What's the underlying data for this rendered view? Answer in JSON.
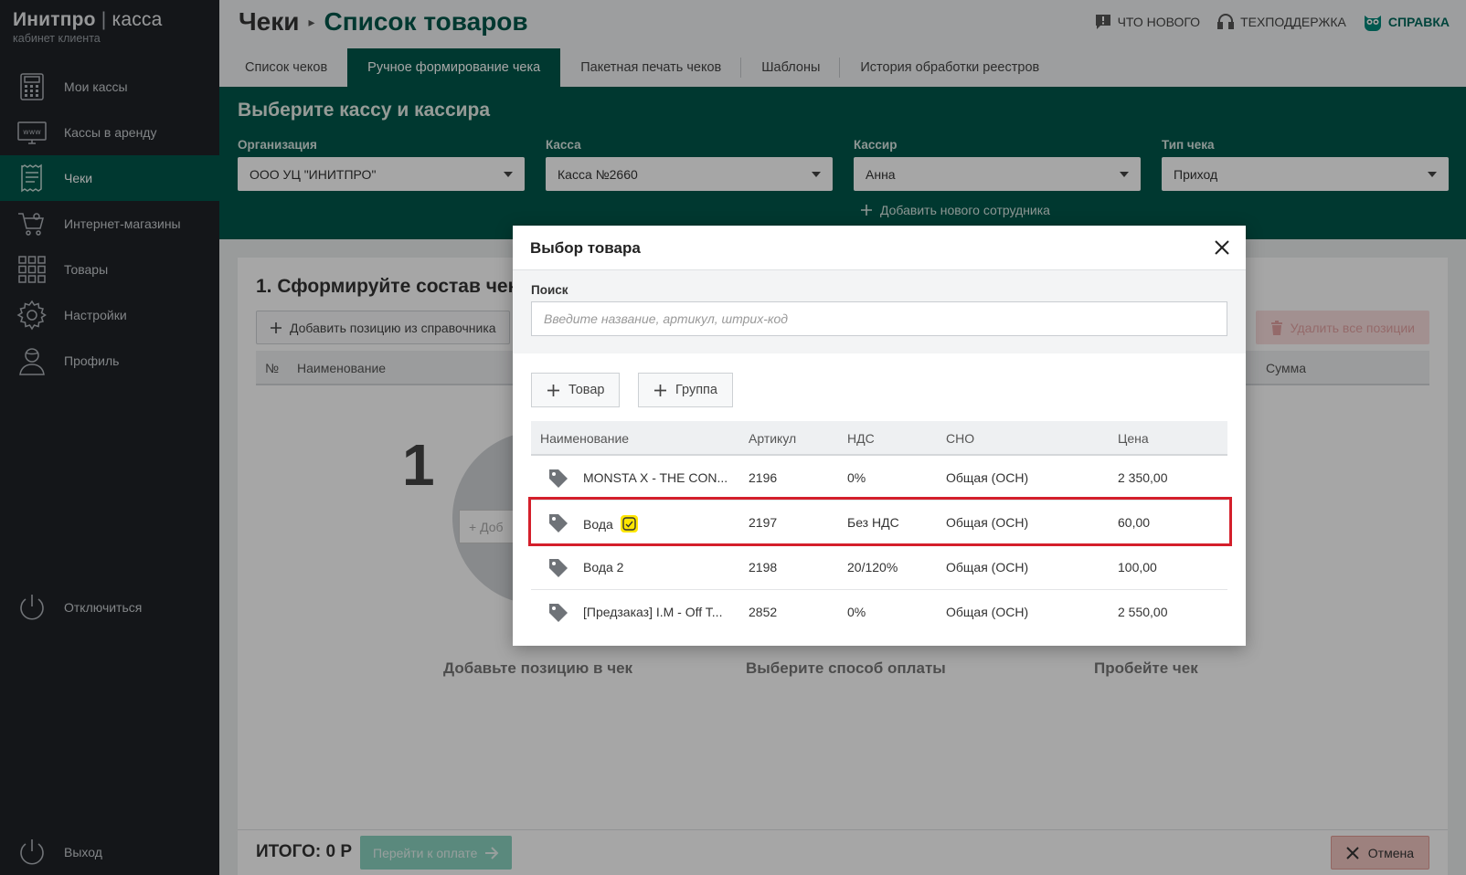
{
  "brand": {
    "name_bold": "Инитпро",
    "separator": "|",
    "name_light": "касса",
    "subtitle": "кабинет клиента"
  },
  "sidebar": {
    "items": [
      {
        "label": "Мои кассы",
        "icon": "cash-register-icon",
        "active": false
      },
      {
        "label": "Кассы в аренду",
        "icon": "monitor-www-icon",
        "active": false
      },
      {
        "label": "Чеки",
        "icon": "receipt-icon",
        "active": true
      },
      {
        "label": "Интернет-магазины",
        "icon": "shopping-cart-icon",
        "active": false
      },
      {
        "label": "Товары",
        "icon": "grid-icon",
        "active": false
      },
      {
        "label": "Настройки",
        "icon": "gear-icon",
        "active": false
      },
      {
        "label": "Профиль",
        "icon": "user-icon",
        "active": false
      }
    ],
    "disconnect_label": "Отключиться",
    "logout_label": "Выход"
  },
  "header": {
    "breadcrumb_parent": "Чеки",
    "breadcrumb_current": "Список товаров",
    "links": {
      "whats_new": "ЧТО НОВОГО",
      "support": "ТЕХПОДДЕРЖКА",
      "help": "СПРАВКА"
    }
  },
  "tabs": [
    {
      "label": "Список чеков",
      "active": false
    },
    {
      "label": "Ручное формирование чека",
      "active": true
    },
    {
      "label": "Пакетная печать чеков",
      "active": false
    },
    {
      "label": "Шаблоны",
      "active": false
    },
    {
      "label": "История обработки реестров",
      "active": false
    }
  ],
  "selection": {
    "title": "Выберите кассу и кассира",
    "organization": {
      "label": "Организация",
      "value": "ООО УЦ \"ИНИТПРО\""
    },
    "register": {
      "label": "Касса",
      "value": "Касса №2660"
    },
    "cashier": {
      "label": "Кассир",
      "value": "Анна"
    },
    "receipt_type": {
      "label": "Тип чека",
      "value": "Приход"
    },
    "add_employee": "Добавить нового сотрудника"
  },
  "main": {
    "section_title": "1. Сформируйте состав чека",
    "add_position_label": "Добавить позицию из справочника",
    "delete_all_label": "Удалить все позиции",
    "table_headers": {
      "num": "№",
      "name": "Наименование",
      "sum": "Сумма"
    },
    "step_number": "1",
    "step_button_label": "+ Доб",
    "steps": [
      "Добавьте позицию в чек",
      "Выберите способ оплаты",
      "Пробейте чек"
    ],
    "total_label": "ИТОГО: 0 Р",
    "pay_label": "Перейти к оплате",
    "cancel_label": "Отмена"
  },
  "modal": {
    "title": "Выбор товара",
    "search_label": "Поиск",
    "search_value": "",
    "search_placeholder": "Введите название, артикул, штрих-код",
    "add_product_label": "Товар",
    "add_group_label": "Группа",
    "columns": {
      "name": "Наименование",
      "sku": "Артикул",
      "vat": "НДС",
      "tax": "СНО",
      "price": "Цена"
    },
    "rows": [
      {
        "name": "MONSTA X - THE CON...",
        "sku": "2196",
        "vat": "0%",
        "tax": "Общая (ОСН)",
        "price": "2 350,00",
        "highlighted": false
      },
      {
        "name": "Вода",
        "sku": "2197",
        "vat": "Без НДС",
        "tax": "Общая (ОСН)",
        "price": "60,00",
        "highlighted": true
      },
      {
        "name": "Вода 2",
        "sku": "2198",
        "vat": "20/120%",
        "tax": "Общая (ОСН)",
        "price": "100,00",
        "highlighted": false
      },
      {
        "name": "[Предзаказ] I.M - Off T...",
        "sku": "2852",
        "vat": "0%",
        "tax": "Общая (ОСН)",
        "price": "2 550,00",
        "highlighted": false
      }
    ]
  },
  "colors": {
    "brand_green": "#00574a",
    "sidebar_bg": "#1f2227",
    "highlight_red": "#d41f2b",
    "badge_yellow": "#ffe600"
  }
}
